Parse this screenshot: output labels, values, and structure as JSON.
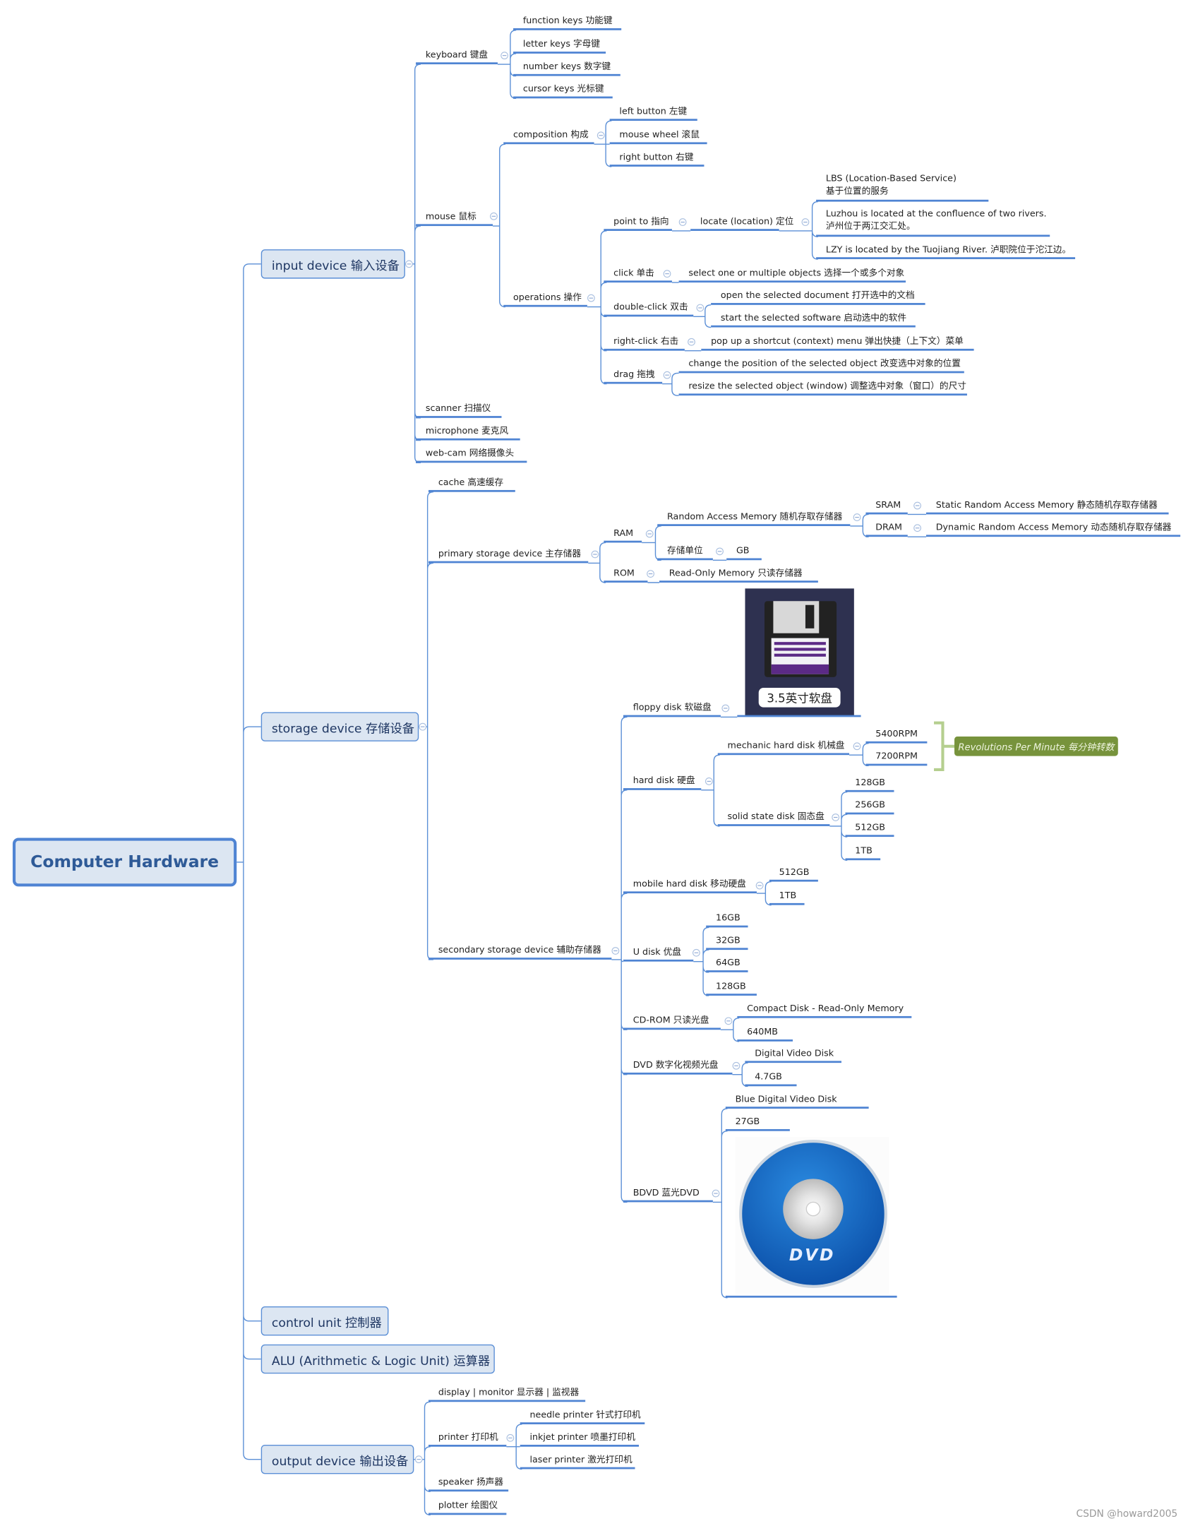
{
  "root": {
    "title": "Computer Hardware"
  },
  "input_device": {
    "label": "input device 输入设备",
    "keyboard": {
      "label": "keyboard 键盘",
      "items": [
        "function keys 功能键",
        "letter keys 字母键",
        "number keys 数字键",
        "cursor keys 光标键"
      ]
    },
    "mouse": {
      "label": "mouse 鼠标",
      "composition": {
        "label": "composition 构成",
        "items": [
          "left button 左键",
          "mouse wheel 滚鼠",
          "right button 右键"
        ]
      },
      "operations": {
        "label": "operations 操作",
        "point_to": {
          "label": "point to 指向",
          "locate": {
            "label": "locate (location) 定位",
            "items": [
              {
                "line1": "LBS (Location-Based Service)",
                "line2": "基于位置的服务"
              },
              {
                "line1": "Luzhou is located at the confluence of two rivers.",
                "line2": "泸州位于两江交汇处。"
              },
              {
                "line1": "LZY is located by the Tuojiang River. 泸职院位于沱江边。"
              }
            ]
          }
        },
        "click": {
          "label": "click 单击",
          "action": "select one or multiple objects 选择一个或多个对象"
        },
        "double_click": {
          "label": "double-click 双击",
          "items": [
            "open the selected document 打开选中的文档",
            "start the selected software 启动选中的软件"
          ]
        },
        "right_click": {
          "label": "right-click 右击",
          "action": "pop up a shortcut (context) menu 弹出快捷（上下文）菜单"
        },
        "drag": {
          "label": "drag 拖拽",
          "items": [
            "change the position of the selected object 改变选中对象的位置",
            "resize the selected object (window) 调整选中对象（窗口）的尺寸"
          ]
        }
      }
    },
    "others": [
      "scanner 扫描仪",
      "microphone 麦克风",
      "web-cam 网络摄像头"
    ]
  },
  "storage_device": {
    "label": "storage device 存储设备",
    "cache": "cache 高速缓存",
    "primary": {
      "label": "primary storage device 主存储器",
      "ram": {
        "label": "RAM",
        "full": {
          "label": "Random Access Memory 随机存取存储器",
          "sram": {
            "label": "SRAM",
            "full": "Static Random Access Memory 静态随机存取存储器"
          },
          "dram": {
            "label": "DRAM",
            "full": "Dynamic Random Access Memory 动态随机存取存储器"
          }
        },
        "unit": {
          "label": "存储单位",
          "value": "GB"
        }
      },
      "rom": {
        "label": "ROM",
        "full": "Read-Only Memory 只读存储器"
      }
    },
    "secondary": {
      "label": "secondary storage device 辅助存储器",
      "floppy": {
        "label": "floppy disk 软磁盘",
        "image_caption": "3.5英寸软盘"
      },
      "hard_disk": {
        "label": "hard disk 硬盘",
        "mechanic": {
          "label": "mechanic hard disk 机械盘",
          "items": [
            "5400RPM",
            "7200RPM"
          ],
          "callout": "Revolutions Per Minute 每分钟转数"
        },
        "ssd": {
          "label": "solid state disk 固态盘",
          "items": [
            "128GB",
            "256GB",
            "512GB",
            "1TB"
          ]
        }
      },
      "mobile": {
        "label": "mobile hard disk 移动硬盘",
        "items": [
          "512GB",
          "1TB"
        ]
      },
      "udisk": {
        "label": "U disk 优盘",
        "items": [
          "16GB",
          "32GB",
          "64GB",
          "128GB"
        ]
      },
      "cdrom": {
        "label": "CD-ROM 只读光盘",
        "items": [
          "Compact Disk - Read-Only Memory",
          "640MB"
        ]
      },
      "dvd": {
        "label": "DVD 数字化视频光盘",
        "items": [
          "Digital Video Disk",
          "4.7GB"
        ]
      },
      "bdvd": {
        "label": "BDVD 蓝光DVD",
        "items": [
          "Blue Digital Video Disk",
          "27GB"
        ],
        "image_logo": "DVD"
      }
    }
  },
  "control_unit": {
    "label": "control unit 控制器"
  },
  "alu": {
    "label": "ALU (Arithmetic & Logic Unit) 运算器"
  },
  "output_device": {
    "label": "output device 输出设备",
    "display": "display | monitor 显示器 | 监视器",
    "printer": {
      "label": "printer 打印机",
      "items": [
        "needle printer 针式打印机",
        "inkjet printer 喷墨打印机",
        "laser printer 激光打印机"
      ]
    },
    "speaker": "speaker 扬声器",
    "plotter": "plotter 绘图仪"
  },
  "watermark": "CSDN @howard2005",
  "colors": {
    "line": "#5b8fd6",
    "node_fill": "#dce6f2",
    "callout": "#77933c",
    "bracket": "#b5cf8f"
  }
}
